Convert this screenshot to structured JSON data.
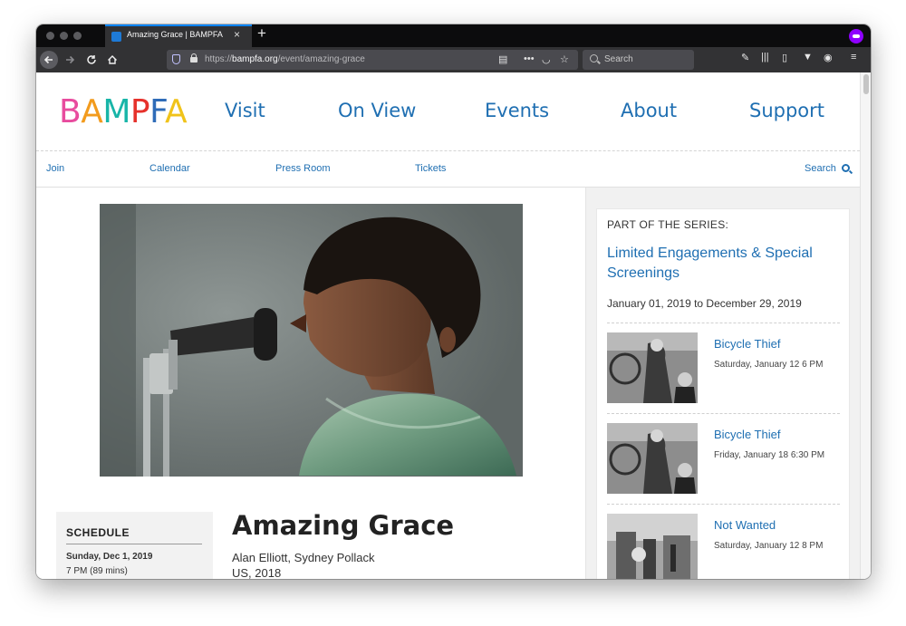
{
  "browser": {
    "tab_title": "Amazing Grace | BAMPFA",
    "tab_close": "×",
    "new_tab": "+",
    "url_prefix": "https://",
    "url_domain": "bampfa.org",
    "url_path": "/event/amazing-grace",
    "search_placeholder": "Search"
  },
  "site": {
    "logo_letters": [
      "B",
      "A",
      "M",
      "P",
      "F",
      "A"
    ],
    "main_nav": [
      "Visit",
      "On View",
      "Events",
      "About",
      "Support"
    ],
    "sub_nav": [
      "Join",
      "Calendar",
      "Press Room",
      "Tickets"
    ],
    "search_label": "Search"
  },
  "event": {
    "schedule_heading": "SCHEDULE",
    "schedule_date": "Sunday, Dec 1, 2019",
    "schedule_time": "7 PM (89 mins)",
    "title": "Amazing Grace",
    "directors": "Alan Elliott, Sydney Pollack",
    "country_year": "US, 2018"
  },
  "series": {
    "kicker": "PART OF THE SERIES:",
    "title": "Limited Engagements & Special Screenings",
    "dates": "January 01, 2019 to December 29, 2019",
    "events": [
      {
        "title": "Bicycle Thief",
        "date": "Saturday, January 12 6 PM"
      },
      {
        "title": "Bicycle Thief",
        "date": "Friday, January 18 6:30 PM"
      },
      {
        "title": "Not Wanted",
        "date": "Saturday, January 12 8 PM"
      }
    ]
  },
  "colors": {
    "link_blue": "#1f6fb2",
    "firefox_private": "#8f00ff",
    "tab_accent": "#0a84ff"
  }
}
